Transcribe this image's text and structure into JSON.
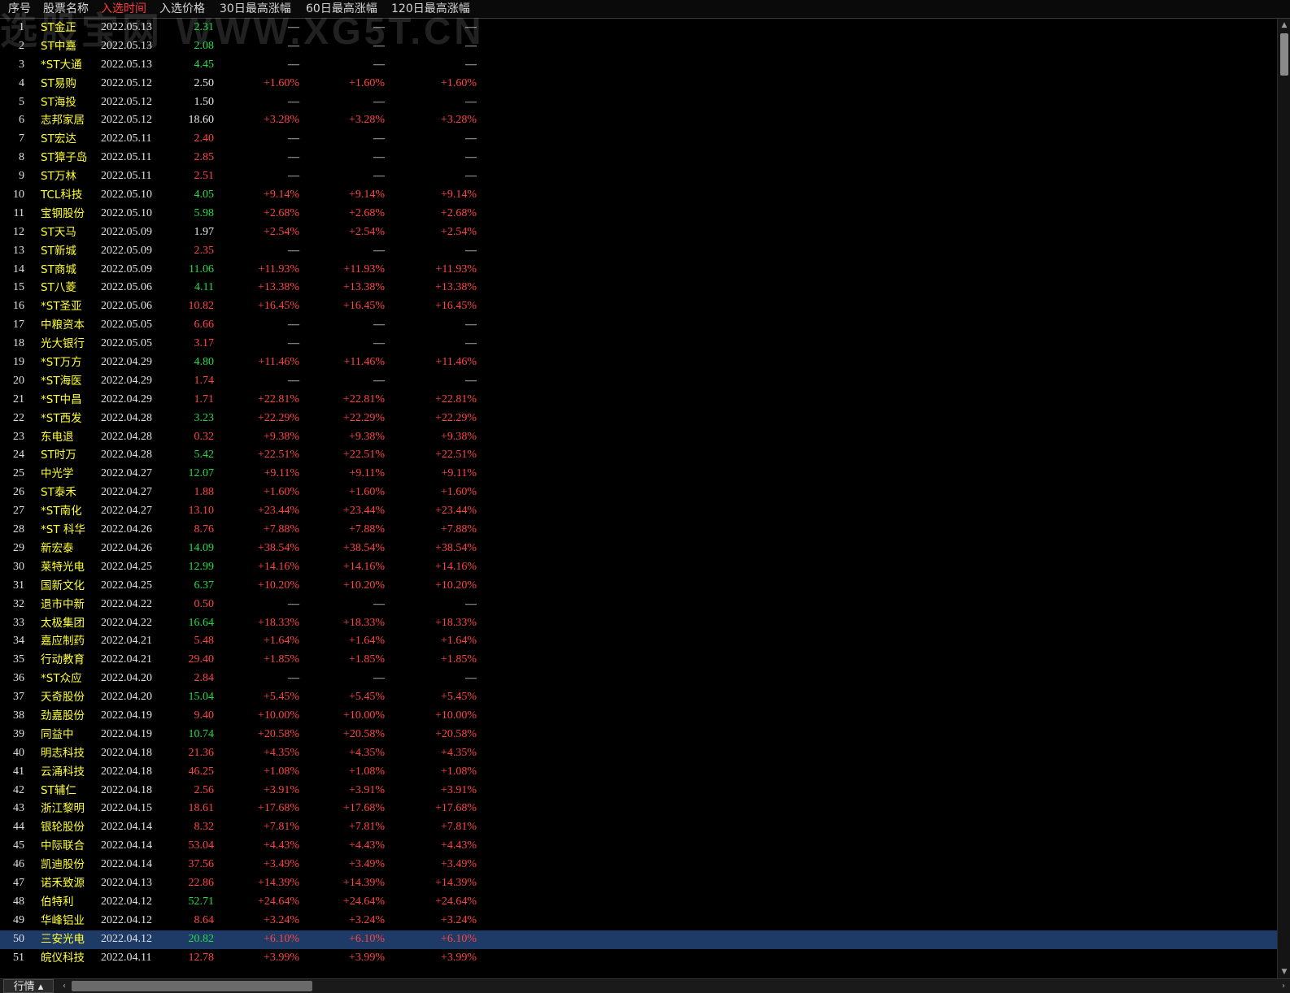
{
  "watermark": "选股宝网  WWW.XG5T.CN",
  "columns": [
    {
      "key": "idx",
      "label": "序号"
    },
    {
      "key": "name",
      "label": "股票名称"
    },
    {
      "key": "date",
      "label": "入选时间"
    },
    {
      "key": "price",
      "label": "入选价格"
    },
    {
      "key": "g30",
      "label": "30日最高涨幅"
    },
    {
      "key": "g60",
      "label": "60日最高涨幅"
    },
    {
      "key": "g120",
      "label": "120日最高涨幅"
    }
  ],
  "active_column": "date",
  "colors": {
    "up": "#ff4444",
    "down": "#22dd44",
    "flat": "#e8e8e8",
    "name": "#ffff33",
    "active_header": "#ff3b3b",
    "selected_row": "#1e3a66"
  },
  "selected_row": 50,
  "rows": [
    {
      "idx": "1",
      "name": "ST金正",
      "date": "2022.05.13",
      "price": "2.31",
      "pc": "down",
      "g30": "—",
      "g60": "—",
      "g120": "—"
    },
    {
      "idx": "2",
      "name": "ST中嘉",
      "date": "2022.05.13",
      "price": "2.08",
      "pc": "down",
      "g30": "—",
      "g60": "—",
      "g120": "—"
    },
    {
      "idx": "3",
      "name": "*ST大通",
      "date": "2022.05.13",
      "price": "4.45",
      "pc": "down",
      "g30": "—",
      "g60": "—",
      "g120": "—"
    },
    {
      "idx": "4",
      "name": "ST易购",
      "date": "2022.05.12",
      "price": "2.50",
      "pc": "flat",
      "g30": "+1.60%",
      "g60": "+1.60%",
      "g120": "+1.60%"
    },
    {
      "idx": "5",
      "name": "ST海投",
      "date": "2022.05.12",
      "price": "1.50",
      "pc": "flat",
      "g30": "—",
      "g60": "—",
      "g120": "—"
    },
    {
      "idx": "6",
      "name": "志邦家居",
      "date": "2022.05.12",
      "price": "18.60",
      "pc": "flat",
      "g30": "+3.28%",
      "g60": "+3.28%",
      "g120": "+3.28%"
    },
    {
      "idx": "7",
      "name": "ST宏达",
      "date": "2022.05.11",
      "price": "2.40",
      "pc": "up",
      "g30": "—",
      "g60": "—",
      "g120": "—"
    },
    {
      "idx": "8",
      "name": "ST獐子岛",
      "date": "2022.05.11",
      "price": "2.85",
      "pc": "up",
      "g30": "—",
      "g60": "—",
      "g120": "—"
    },
    {
      "idx": "9",
      "name": "ST万林",
      "date": "2022.05.11",
      "price": "2.51",
      "pc": "up",
      "g30": "—",
      "g60": "—",
      "g120": "—"
    },
    {
      "idx": "10",
      "name": "TCL科技",
      "date": "2022.05.10",
      "price": "4.05",
      "pc": "down",
      "g30": "+9.14%",
      "g60": "+9.14%",
      "g120": "+9.14%"
    },
    {
      "idx": "11",
      "name": "宝钢股份",
      "date": "2022.05.10",
      "price": "5.98",
      "pc": "down",
      "g30": "+2.68%",
      "g60": "+2.68%",
      "g120": "+2.68%"
    },
    {
      "idx": "12",
      "name": "ST天马",
      "date": "2022.05.09",
      "price": "1.97",
      "pc": "flat",
      "g30": "+2.54%",
      "g60": "+2.54%",
      "g120": "+2.54%"
    },
    {
      "idx": "13",
      "name": "ST新城",
      "date": "2022.05.09",
      "price": "2.35",
      "pc": "up",
      "g30": "—",
      "g60": "—",
      "g120": "—"
    },
    {
      "idx": "14",
      "name": "ST商城",
      "date": "2022.05.09",
      "price": "11.06",
      "pc": "down",
      "g30": "+11.93%",
      "g60": "+11.93%",
      "g120": "+11.93%"
    },
    {
      "idx": "15",
      "name": "ST八菱",
      "date": "2022.05.06",
      "price": "4.11",
      "pc": "down",
      "g30": "+13.38%",
      "g60": "+13.38%",
      "g120": "+13.38%"
    },
    {
      "idx": "16",
      "name": "*ST圣亚",
      "date": "2022.05.06",
      "price": "10.82",
      "pc": "up",
      "g30": "+16.45%",
      "g60": "+16.45%",
      "g120": "+16.45%"
    },
    {
      "idx": "17",
      "name": "中粮资本",
      "date": "2022.05.05",
      "price": "6.66",
      "pc": "up",
      "g30": "—",
      "g60": "—",
      "g120": "—"
    },
    {
      "idx": "18",
      "name": "光大银行",
      "date": "2022.05.05",
      "price": "3.17",
      "pc": "up",
      "g30": "—",
      "g60": "—",
      "g120": "—"
    },
    {
      "idx": "19",
      "name": "*ST万方",
      "date": "2022.04.29",
      "price": "4.80",
      "pc": "down",
      "g30": "+11.46%",
      "g60": "+11.46%",
      "g120": "+11.46%"
    },
    {
      "idx": "20",
      "name": "*ST海医",
      "date": "2022.04.29",
      "price": "1.74",
      "pc": "up",
      "g30": "—",
      "g60": "—",
      "g120": "—"
    },
    {
      "idx": "21",
      "name": "*ST中昌",
      "date": "2022.04.29",
      "price": "1.71",
      "pc": "up",
      "g30": "+22.81%",
      "g60": "+22.81%",
      "g120": "+22.81%"
    },
    {
      "idx": "22",
      "name": "*ST西发",
      "date": "2022.04.28",
      "price": "3.23",
      "pc": "down",
      "g30": "+22.29%",
      "g60": "+22.29%",
      "g120": "+22.29%"
    },
    {
      "idx": "23",
      "name": "东电退",
      "date": "2022.04.28",
      "price": "0.32",
      "pc": "up",
      "g30": "+9.38%",
      "g60": "+9.38%",
      "g120": "+9.38%"
    },
    {
      "idx": "24",
      "name": "ST时万",
      "date": "2022.04.28",
      "price": "5.42",
      "pc": "down",
      "g30": "+22.51%",
      "g60": "+22.51%",
      "g120": "+22.51%"
    },
    {
      "idx": "25",
      "name": "中光学",
      "date": "2022.04.27",
      "price": "12.07",
      "pc": "down",
      "g30": "+9.11%",
      "g60": "+9.11%",
      "g120": "+9.11%"
    },
    {
      "idx": "26",
      "name": "ST泰禾",
      "date": "2022.04.27",
      "price": "1.88",
      "pc": "up",
      "g30": "+1.60%",
      "g60": "+1.60%",
      "g120": "+1.60%"
    },
    {
      "idx": "27",
      "name": "*ST南化",
      "date": "2022.04.27",
      "price": "13.10",
      "pc": "up",
      "g30": "+23.44%",
      "g60": "+23.44%",
      "g120": "+23.44%"
    },
    {
      "idx": "28",
      "name": "*ST 科华",
      "date": "2022.04.26",
      "price": "8.76",
      "pc": "up",
      "g30": "+7.88%",
      "g60": "+7.88%",
      "g120": "+7.88%"
    },
    {
      "idx": "29",
      "name": "新宏泰",
      "date": "2022.04.26",
      "price": "14.09",
      "pc": "down",
      "g30": "+38.54%",
      "g60": "+38.54%",
      "g120": "+38.54%"
    },
    {
      "idx": "30",
      "name": "莱特光电",
      "date": "2022.04.25",
      "price": "12.99",
      "pc": "down",
      "g30": "+14.16%",
      "g60": "+14.16%",
      "g120": "+14.16%"
    },
    {
      "idx": "31",
      "name": "国新文化",
      "date": "2022.04.25",
      "price": "6.37",
      "pc": "down",
      "g30": "+10.20%",
      "g60": "+10.20%",
      "g120": "+10.20%"
    },
    {
      "idx": "32",
      "name": "退市中新",
      "date": "2022.04.22",
      "price": "0.50",
      "pc": "up",
      "g30": "—",
      "g60": "—",
      "g120": "—"
    },
    {
      "idx": "33",
      "name": "太极集团",
      "date": "2022.04.22",
      "price": "16.64",
      "pc": "down",
      "g30": "+18.33%",
      "g60": "+18.33%",
      "g120": "+18.33%"
    },
    {
      "idx": "34",
      "name": "嘉应制药",
      "date": "2022.04.21",
      "price": "5.48",
      "pc": "up",
      "g30": "+1.64%",
      "g60": "+1.64%",
      "g120": "+1.64%"
    },
    {
      "idx": "35",
      "name": "行动教育",
      "date": "2022.04.21",
      "price": "29.40",
      "pc": "up",
      "g30": "+1.85%",
      "g60": "+1.85%",
      "g120": "+1.85%"
    },
    {
      "idx": "36",
      "name": "*ST众应",
      "date": "2022.04.20",
      "price": "2.84",
      "pc": "up",
      "g30": "—",
      "g60": "—",
      "g120": "—"
    },
    {
      "idx": "37",
      "name": "天奇股份",
      "date": "2022.04.20",
      "price": "15.04",
      "pc": "down",
      "g30": "+5.45%",
      "g60": "+5.45%",
      "g120": "+5.45%"
    },
    {
      "idx": "38",
      "name": "劲嘉股份",
      "date": "2022.04.19",
      "price": "9.40",
      "pc": "up",
      "g30": "+10.00%",
      "g60": "+10.00%",
      "g120": "+10.00%"
    },
    {
      "idx": "39",
      "name": "同益中",
      "date": "2022.04.19",
      "price": "10.74",
      "pc": "down",
      "g30": "+20.58%",
      "g60": "+20.58%",
      "g120": "+20.58%"
    },
    {
      "idx": "40",
      "name": "明志科技",
      "date": "2022.04.18",
      "price": "21.36",
      "pc": "up",
      "g30": "+4.35%",
      "g60": "+4.35%",
      "g120": "+4.35%"
    },
    {
      "idx": "41",
      "name": "云涌科技",
      "date": "2022.04.18",
      "price": "46.25",
      "pc": "up",
      "g30": "+1.08%",
      "g60": "+1.08%",
      "g120": "+1.08%"
    },
    {
      "idx": "42",
      "name": "ST辅仁",
      "date": "2022.04.18",
      "price": "2.56",
      "pc": "up",
      "g30": "+3.91%",
      "g60": "+3.91%",
      "g120": "+3.91%"
    },
    {
      "idx": "43",
      "name": "浙江黎明",
      "date": "2022.04.15",
      "price": "18.61",
      "pc": "up",
      "g30": "+17.68%",
      "g60": "+17.68%",
      "g120": "+17.68%"
    },
    {
      "idx": "44",
      "name": "银轮股份",
      "date": "2022.04.14",
      "price": "8.32",
      "pc": "up",
      "g30": "+7.81%",
      "g60": "+7.81%",
      "g120": "+7.81%"
    },
    {
      "idx": "45",
      "name": "中际联合",
      "date": "2022.04.14",
      "price": "53.04",
      "pc": "up",
      "g30": "+4.43%",
      "g60": "+4.43%",
      "g120": "+4.43%"
    },
    {
      "idx": "46",
      "name": "凯迪股份",
      "date": "2022.04.14",
      "price": "37.56",
      "pc": "up",
      "g30": "+3.49%",
      "g60": "+3.49%",
      "g120": "+3.49%"
    },
    {
      "idx": "47",
      "name": "诺禾致源",
      "date": "2022.04.13",
      "price": "22.86",
      "pc": "up",
      "g30": "+14.39%",
      "g60": "+14.39%",
      "g120": "+14.39%"
    },
    {
      "idx": "48",
      "name": "伯特利",
      "date": "2022.04.12",
      "price": "52.71",
      "pc": "down",
      "g30": "+24.64%",
      "g60": "+24.64%",
      "g120": "+24.64%"
    },
    {
      "idx": "49",
      "name": "华峰铝业",
      "date": "2022.04.12",
      "price": "8.64",
      "pc": "up",
      "g30": "+3.24%",
      "g60": "+3.24%",
      "g120": "+3.24%"
    },
    {
      "idx": "50",
      "name": "三安光电",
      "date": "2022.04.12",
      "price": "20.82",
      "pc": "down",
      "g30": "+6.10%",
      "g60": "+6.10%",
      "g120": "+6.10%"
    },
    {
      "idx": "51",
      "name": "皖仪科技",
      "date": "2022.04.11",
      "price": "12.78",
      "pc": "up",
      "g30": "+3.99%",
      "g60": "+3.99%",
      "g120": "+3.99%"
    }
  ],
  "footer": {
    "tab_label": "行情 ▴",
    "scroll_left_icon": "chevron-left-icon",
    "scroll_right_icon": "chevron-right-icon"
  },
  "vscroll": {
    "up_icon": "triangle-up-icon",
    "down_icon": "triangle-down-icon"
  }
}
